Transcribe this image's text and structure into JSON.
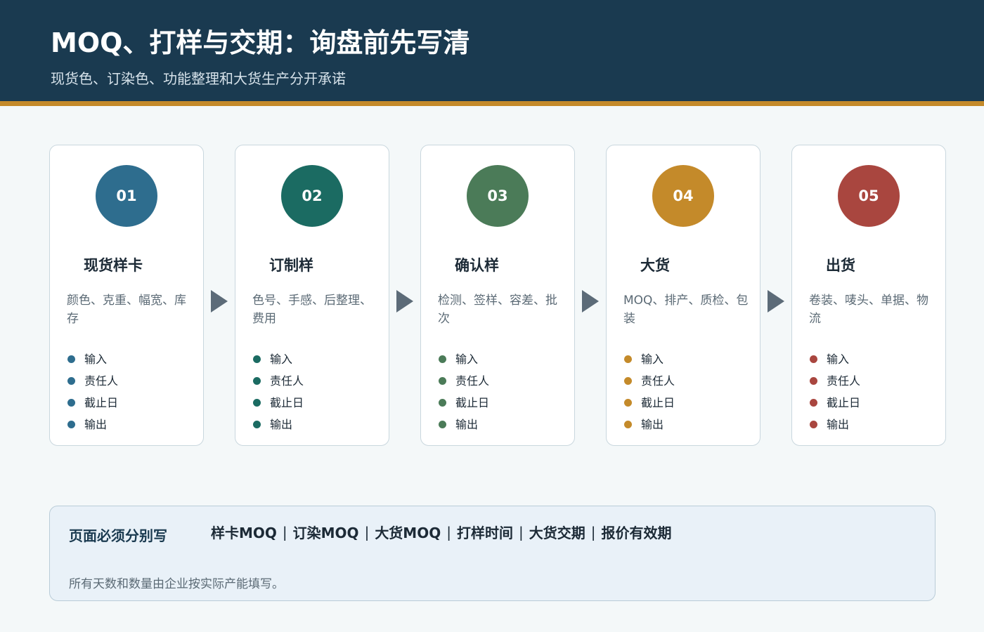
{
  "header": {
    "title": "MOQ、打样与交期：询盘前先写清",
    "subtitle": "现货色、订染色、功能整理和大货生产分开承诺"
  },
  "colors": {
    "header_bg": "#1a3a50",
    "accent_bar": "#c48a2a",
    "arrow": "#5c6b78"
  },
  "steps": [
    {
      "number": "01",
      "title": "现货样卡",
      "desc": "颜色、克重、幅宽、库存",
      "color": "#2e6d8e",
      "items": [
        "输入",
        "责任人",
        "截止日",
        "输出"
      ]
    },
    {
      "number": "02",
      "title": "订制样",
      "desc": "色号、手感、后整理、费用",
      "color": "#1b6b62",
      "items": [
        "输入",
        "责任人",
        "截止日",
        "输出"
      ]
    },
    {
      "number": "03",
      "title": "确认样",
      "desc": "检测、签样、容差、批次",
      "color": "#4b7b58",
      "items": [
        "输入",
        "责任人",
        "截止日",
        "输出"
      ]
    },
    {
      "number": "04",
      "title": "大货",
      "desc": "MOQ、排产、质检、包装",
      "color": "#c48a2a",
      "items": [
        "输入",
        "责任人",
        "截止日",
        "输出"
      ]
    },
    {
      "number": "05",
      "title": "出货",
      "desc": "卷装、唛头、单据、物流",
      "color": "#a9463f",
      "items": [
        "输入",
        "责任人",
        "截止日",
        "输出"
      ]
    }
  ],
  "note": {
    "label": "页面必须分别写",
    "items": [
      "样卡MOQ",
      "订染MOQ",
      "大货MOQ",
      "打样时间",
      "大货交期",
      "报价有效期"
    ],
    "separator": "|",
    "footnote": "所有天数和数量由企业按实际产能填写。"
  }
}
